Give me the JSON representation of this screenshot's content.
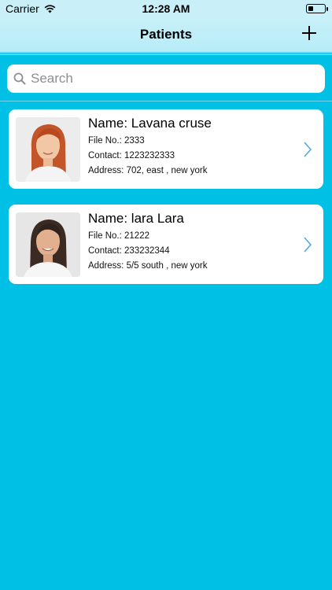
{
  "status_bar": {
    "carrier": "Carrier",
    "time": "12:28 AM",
    "icons": [
      "wifi-icon",
      "battery-icon"
    ]
  },
  "nav": {
    "title": "Patients",
    "add_icon": "plus-icon"
  },
  "search": {
    "placeholder": "Search",
    "value": ""
  },
  "patients": [
    {
      "name": "Name: Lavana cruse",
      "file_no": "File No.: 2333",
      "contact": "Contact: 1223232333",
      "address": "Address: 702, east , new york",
      "avatar": "woman-red-hair-photo"
    },
    {
      "name": "Name: lara Lara",
      "file_no": "File No.: 21222",
      "contact": "Contact: 233232344",
      "address": "Address: 5/5 south , new york",
      "avatar": "woman-dark-hair-photo"
    }
  ],
  "colors": {
    "background": "#00c0e6",
    "nav_background": "#c9f0f9",
    "card_background": "#ffffff",
    "chevron": "#4aa8dc"
  }
}
